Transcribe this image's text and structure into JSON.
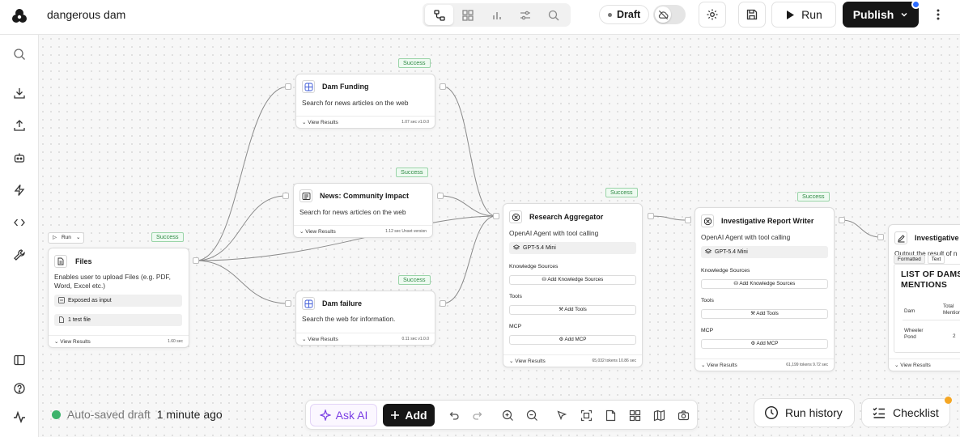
{
  "header": {
    "project_title": "dangerous dam",
    "view_tabs": [
      "workflow-icon",
      "grid-icon",
      "chart-icon",
      "sliders-icon",
      "search-icon"
    ],
    "status": "Draft",
    "run_label": "Run",
    "publish_label": "Publish"
  },
  "sidebar": {
    "items": [
      "search-icon",
      "download-icon",
      "upload-icon",
      "bot-icon",
      "zap-icon",
      "code-icon",
      "wrench-icon"
    ],
    "bottom_items": [
      "panel-icon",
      "help-icon",
      "activity-icon"
    ]
  },
  "nodes": {
    "files": {
      "title": "Files",
      "desc": "Enables user to upload Files (e.g. PDF, Word, Excel etc.)",
      "chip1": "Exposed as input",
      "chip2": "1 test file",
      "footer": "View Results",
      "meta": "1.60 sec",
      "status": "Success",
      "run": "Run"
    },
    "dam_funding": {
      "title": "Dam Funding",
      "desc": "Search for news articles on the web",
      "footer": "View Results",
      "meta": "1.07 sec   v1.0.0",
      "status": "Success"
    },
    "community": {
      "title": "News: Community Impact",
      "desc": "Search for news articles on the web",
      "footer": "View Results",
      "meta": "1.12 sec   Unset version",
      "status": "Success"
    },
    "dam_failure": {
      "title": "Dam failure",
      "desc": "Search the web for information.",
      "footer": "View Results",
      "meta": "0.11 sec   v1.0.0",
      "status": "Success"
    },
    "aggregator": {
      "title": "Research Aggregator",
      "desc": "OpenAI Agent with tool calling",
      "model": "GPT-5.4 Mini",
      "knowledge_label": "Knowledge Sources",
      "knowledge_btn": "Add Knowledge Sources",
      "tools_label": "Tools",
      "tools_btn": "Add Tools",
      "mcp_label": "MCP",
      "mcp_btn": "Add MCP",
      "footer": "View Results",
      "meta": "65,032 tokens   10.86 sec",
      "status": "Success"
    },
    "writer": {
      "title": "Investigative Report Writer",
      "desc": "OpenAI Agent with tool calling",
      "model": "GPT-5.4 Mini",
      "knowledge_label": "Knowledge Sources",
      "knowledge_btn": "Add Knowledge Sources",
      "tools_label": "Tools",
      "tools_btn": "Add Tools",
      "mcp_label": "MCP",
      "mcp_btn": "Add MCP",
      "footer": "View Results",
      "meta": "61,199 tokens   9.72 sec",
      "status": "Success"
    },
    "output": {
      "title": "Investigative R",
      "desc": "Output the result of n",
      "tab_formatted": "Formatted",
      "tab_text": "Text",
      "heading": "LIST OF DAMS MENTIONS",
      "col1": "Dam",
      "col2": "Total Mentions",
      "row1_dam": "Wheeler Pond",
      "row1_count": "2",
      "footer": "View Results"
    }
  },
  "footer": {
    "autosave_label": "Auto-saved draft",
    "autosave_time": "1 minute ago",
    "ask_ai": "Ask AI",
    "add": "Add",
    "run_history": "Run history",
    "checklist": "Checklist"
  }
}
